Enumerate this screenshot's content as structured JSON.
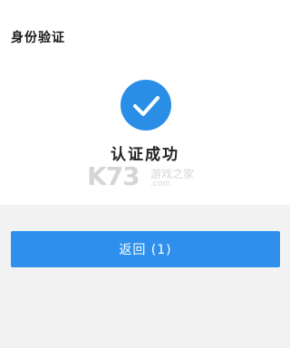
{
  "header": {
    "title": "身份验证"
  },
  "status": {
    "icon": "check-circle-icon",
    "message": "认证成功",
    "accent_color": "#2a8ee6"
  },
  "watermark": {
    "logo_text": "K73",
    "line1": "游戏之家",
    "line2": ".com"
  },
  "actions": {
    "back_label": "返回 (1)",
    "button_color": "#2e90ec"
  }
}
